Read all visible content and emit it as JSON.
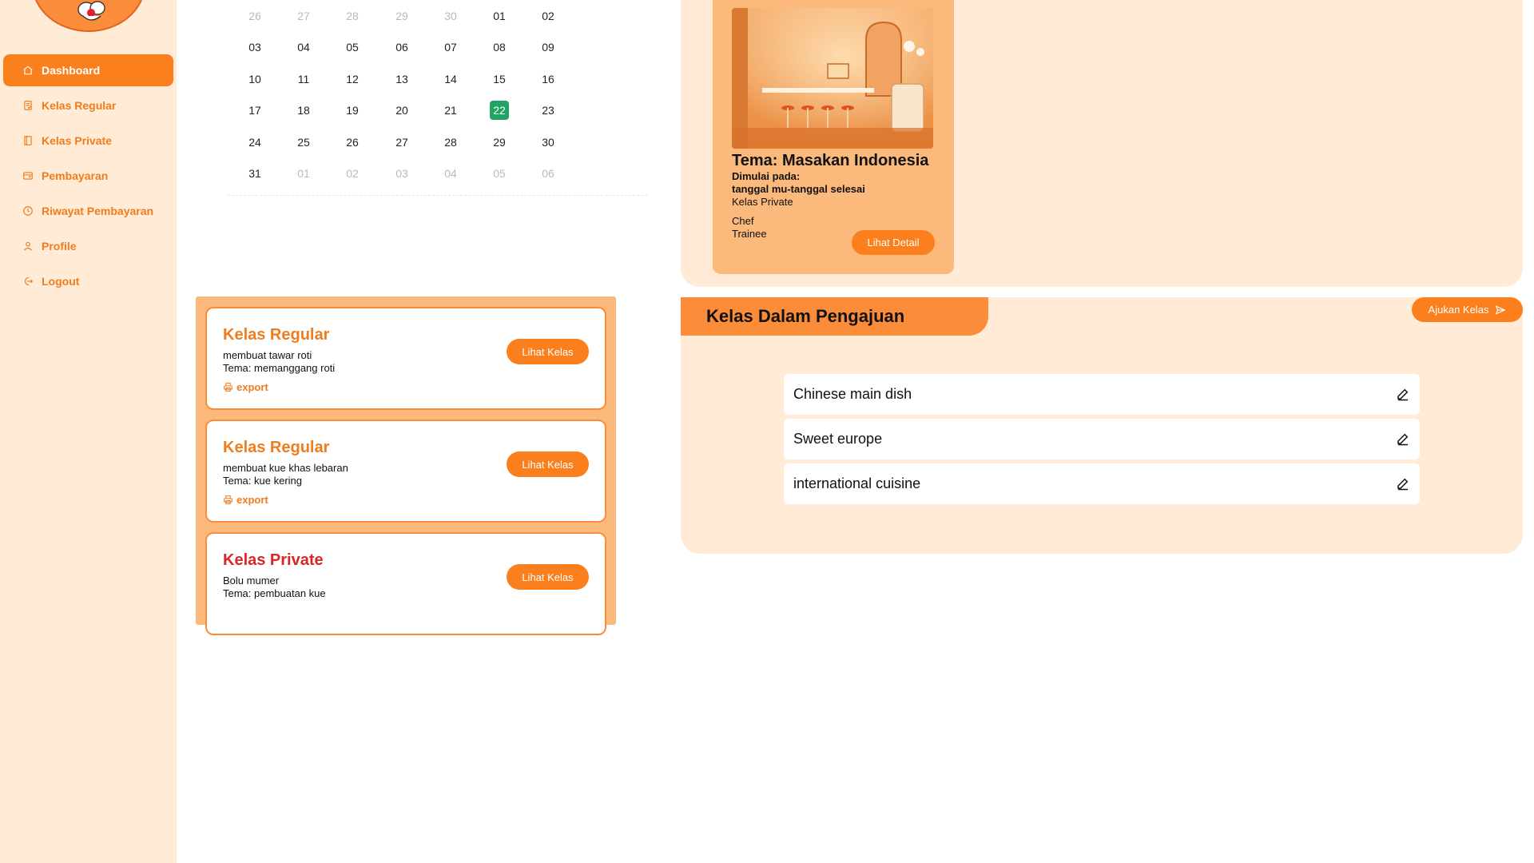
{
  "sidebar": {
    "items": [
      {
        "label": "Dashboard",
        "icon": "home-icon",
        "active": true
      },
      {
        "label": "Kelas Regular",
        "icon": "document-list-icon",
        "active": false
      },
      {
        "label": "Kelas Private",
        "icon": "notebook-icon",
        "active": false
      },
      {
        "label": "Pembayaran",
        "icon": "wallet-icon",
        "active": false
      },
      {
        "label": "Riwayat Pembayaran",
        "icon": "clock-icon",
        "active": false
      },
      {
        "label": "Profile",
        "icon": "user-icon",
        "active": false
      },
      {
        "label": "Logout",
        "icon": "logout-icon",
        "active": false
      }
    ]
  },
  "calendar": {
    "weeks": [
      [
        {
          "d": "26",
          "m": true
        },
        {
          "d": "27",
          "m": true
        },
        {
          "d": "28",
          "m": true
        },
        {
          "d": "29",
          "m": true
        },
        {
          "d": "30",
          "m": true
        },
        {
          "d": "01",
          "m": false
        },
        {
          "d": "02",
          "m": false
        }
      ],
      [
        {
          "d": "03",
          "m": false
        },
        {
          "d": "04",
          "m": false
        },
        {
          "d": "05",
          "m": false
        },
        {
          "d": "06",
          "m": false
        },
        {
          "d": "07",
          "m": false
        },
        {
          "d": "08",
          "m": false
        },
        {
          "d": "09",
          "m": false
        }
      ],
      [
        {
          "d": "10",
          "m": false
        },
        {
          "d": "11",
          "m": false
        },
        {
          "d": "12",
          "m": false
        },
        {
          "d": "13",
          "m": false
        },
        {
          "d": "14",
          "m": false
        },
        {
          "d": "15",
          "m": false
        },
        {
          "d": "16",
          "m": false
        }
      ],
      [
        {
          "d": "17",
          "m": false
        },
        {
          "d": "18",
          "m": false
        },
        {
          "d": "19",
          "m": false
        },
        {
          "d": "20",
          "m": false
        },
        {
          "d": "21",
          "m": false
        },
        {
          "d": "22",
          "m": false,
          "today": true
        },
        {
          "d": "23",
          "m": false
        }
      ],
      [
        {
          "d": "24",
          "m": false
        },
        {
          "d": "25",
          "m": false
        },
        {
          "d": "26",
          "m": false
        },
        {
          "d": "27",
          "m": false
        },
        {
          "d": "28",
          "m": false
        },
        {
          "d": "29",
          "m": false
        },
        {
          "d": "30",
          "m": false
        }
      ],
      [
        {
          "d": "31",
          "m": false
        },
        {
          "d": "01",
          "m": true
        },
        {
          "d": "02",
          "m": true
        },
        {
          "d": "03",
          "m": true
        },
        {
          "d": "04",
          "m": true
        },
        {
          "d": "05",
          "m": true
        },
        {
          "d": "06",
          "m": true
        }
      ]
    ]
  },
  "classes": [
    {
      "title": "Kelas Regular",
      "type": "regular",
      "line1": "membuat tawar roti",
      "line2": "Tema: memanggang roti",
      "export_label": "export",
      "button": "Lihat Kelas"
    },
    {
      "title": "Kelas Regular",
      "type": "regular",
      "line1": "membuat kue khas lebaran",
      "line2": "Tema: kue kering",
      "export_label": "export",
      "button": "Lihat Kelas"
    },
    {
      "title": "Kelas Private",
      "type": "private",
      "line1": "Bolu mumer",
      "line2": "Tema: pembuatan kue",
      "export_label": null,
      "button": "Lihat Kelas"
    }
  ],
  "feature": {
    "title": "Tema: Masakan Indonesia",
    "started_label": "Dimulai pada:",
    "dates": "tanggal mu-tanggal selesai",
    "kind": "Kelas Private",
    "chef": "Chef",
    "trainee": "Trainee",
    "button": "Lihat Detail"
  },
  "pengajuan": {
    "title": "Kelas Dalam Pengajuan",
    "submit_button": "Ajukan Kelas",
    "items": [
      "Chinese main dish",
      "Sweet europe",
      "international cuisine"
    ]
  },
  "colors": {
    "accent": "#fb7f1c",
    "accent_text": "#f07c1e",
    "private_title": "#dc2626",
    "panel": "#fbb97c",
    "background_soft": "#ffebd6",
    "today": "#1fa463"
  }
}
